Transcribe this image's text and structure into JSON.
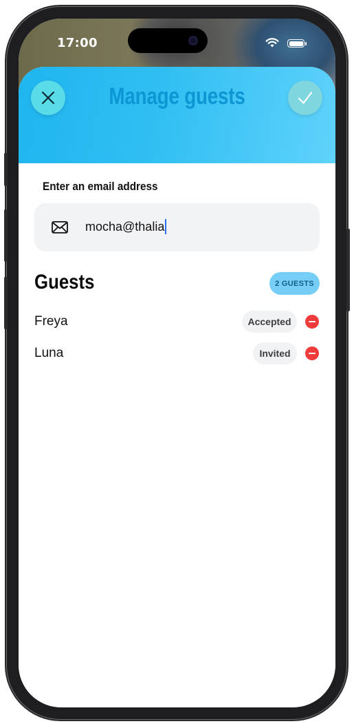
{
  "status_bar": {
    "time": "17:00"
  },
  "header": {
    "title": "Manage guests",
    "close_icon": "close-icon",
    "confirm_icon": "checkmark-icon",
    "background_color": "#31bff2",
    "title_color": "#0c97d4"
  },
  "email": {
    "label": "Enter an email address",
    "value": "mocha@thalia",
    "icon": "mail-icon"
  },
  "guests": {
    "title": "Guests",
    "count_badge": "2 GUESTS",
    "items": [
      {
        "name": "Freya",
        "status": "Accepted"
      },
      {
        "name": "Luna",
        "status": "Invited"
      }
    ]
  },
  "colors": {
    "remove": "#ef3b3b",
    "badge": "#76cef7",
    "caret": "#2a6df4"
  }
}
